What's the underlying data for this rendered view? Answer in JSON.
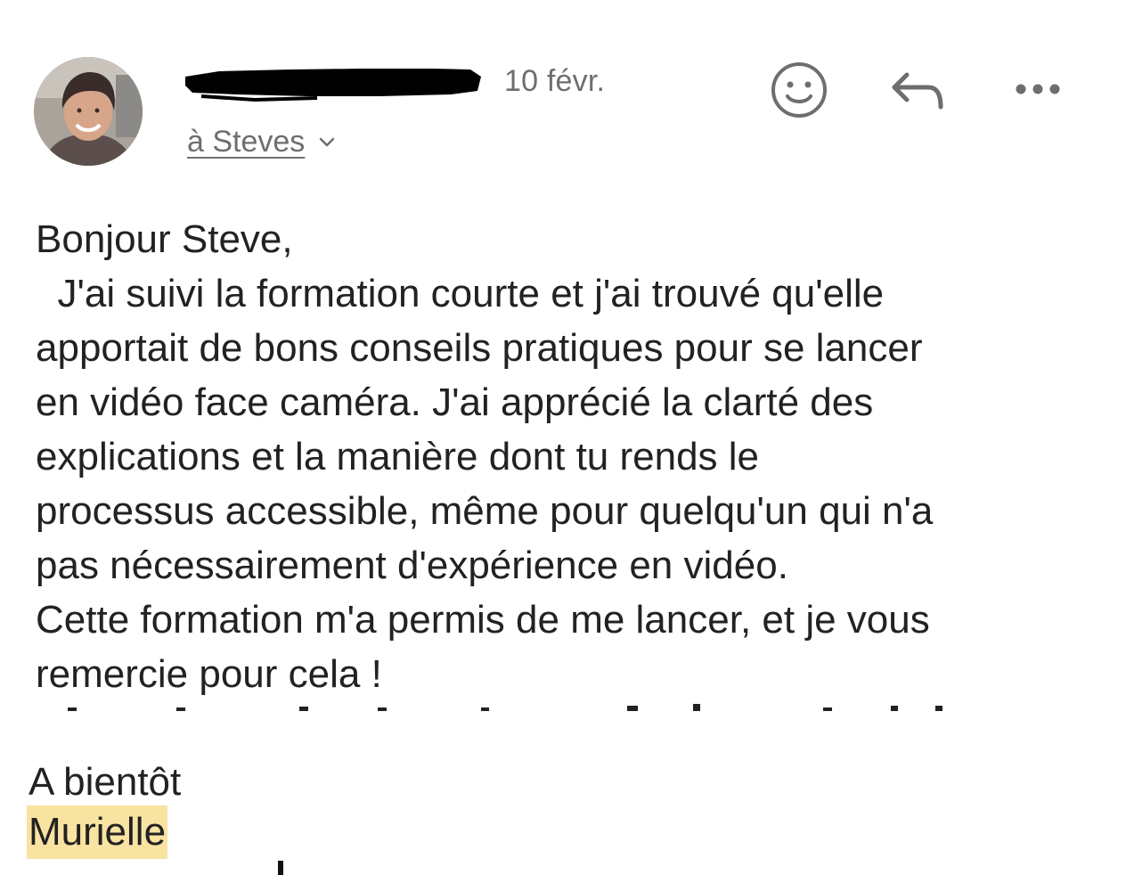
{
  "header": {
    "date": "10 févr.",
    "recipient": "à Steves",
    "icons": {
      "avatar": "avatar-photo",
      "emoji": "smiley-icon",
      "reply": "reply-arrow-icon",
      "more": "more-dots-icon",
      "chevron": "chevron-down-icon"
    }
  },
  "message": {
    "lines": [
      "Bonjour Steve,",
      "  J'ai suivi la formation courte et j'ai trouvé qu'elle",
      "apportait de bons conseils pratiques pour se lancer",
      "en vidéo face caméra. J'ai apprécié la clarté des",
      "explications et la manière dont tu rends le",
      "processus accessible, même pour quelqu'un qui n'a",
      "pas nécessairement d'expérience en vidéo.",
      "Cette formation m'a permis de me lancer, et je vous",
      "remercie pour cela !"
    ],
    "closing": "A bientôt",
    "signature": "Murielle"
  },
  "colors": {
    "text": "#222222",
    "muted": "#6e6e6e",
    "signature_highlight": "#f9e3a1",
    "redaction": "#000000"
  }
}
